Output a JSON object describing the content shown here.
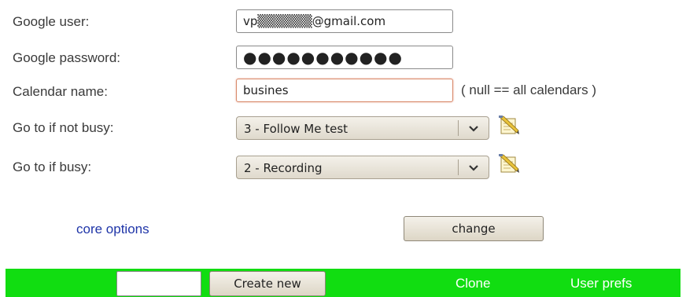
{
  "form": {
    "google_user": {
      "label": "Google user:",
      "value": "vp▒▒▒▒▒▒@gmail.com"
    },
    "google_password": {
      "label": "Google password:",
      "value": "●●●●●●●●●●●"
    },
    "calendar_name": {
      "label": "Calendar name:",
      "value": "busines",
      "hint": "( null == all calendars )"
    },
    "not_busy": {
      "label": "Go to if not busy:",
      "selected": "3 - Follow Me test",
      "edit_icon": "edit-notepad-icon"
    },
    "busy": {
      "label": "Go to if busy:",
      "selected": "2 - Recording",
      "edit_icon": "edit-notepad-icon"
    }
  },
  "actions": {
    "core_options": "core options",
    "change": "change"
  },
  "bottom_bar": {
    "color": "#11dd11",
    "new_name_value": "",
    "create_new": "Create new",
    "clone": "Clone",
    "user_prefs": "User prefs"
  }
}
